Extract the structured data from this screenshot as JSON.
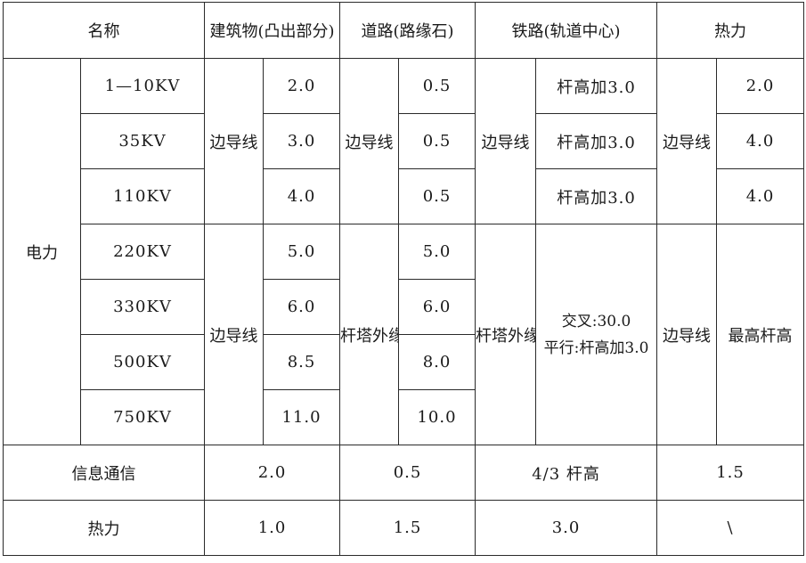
{
  "header": {
    "name": "名称",
    "building": "建筑物(凸出部分)",
    "road": "道路(路缘石)",
    "railway": "铁路(轨道中心)",
    "heat": "热力"
  },
  "power": {
    "label": "电力",
    "rows": [
      {
        "voltage": "1—10KV",
        "building": "2.0",
        "road": "0.5",
        "railway": "杆高加3.0",
        "heat": "2.0"
      },
      {
        "voltage": "35KV",
        "building": "3.0",
        "road": "0.5",
        "railway": "杆高加3.0",
        "heat": "4.0"
      },
      {
        "voltage": "110KV",
        "building": "4.0",
        "road": "0.5",
        "railway": "杆高加3.0",
        "heat": "4.0"
      },
      {
        "voltage": "220KV",
        "building": "5.0",
        "road": "5.0"
      },
      {
        "voltage": "330KV",
        "building": "6.0",
        "road": "6.0"
      },
      {
        "voltage": "500KV",
        "building": "8.5",
        "road": "8.0"
      },
      {
        "voltage": "750KV",
        "building": "11.0",
        "road": "10.0"
      }
    ],
    "low_group": {
      "building_ref": "边导线",
      "road_ref": "边导线",
      "railway_ref": "边导线",
      "heat_ref": "边导线"
    },
    "high_group": {
      "building_ref": "边导线",
      "road_ref": "杆塔外缘",
      "railway_ref": "杆塔外缘",
      "railway_cross": "交叉:30.0",
      "railway_parallel": "平行:杆高加3.0",
      "heat_ref": "边导线",
      "heat_value": "最高杆高"
    }
  },
  "telecom": {
    "label": "信息通信",
    "building": "2.0",
    "road": "0.5",
    "railway": "4/3 杆高",
    "heat": "1.5"
  },
  "heat_row": {
    "label": "热力",
    "building": "1.0",
    "road": "1.5",
    "railway": "3.0",
    "heat": "\\"
  }
}
